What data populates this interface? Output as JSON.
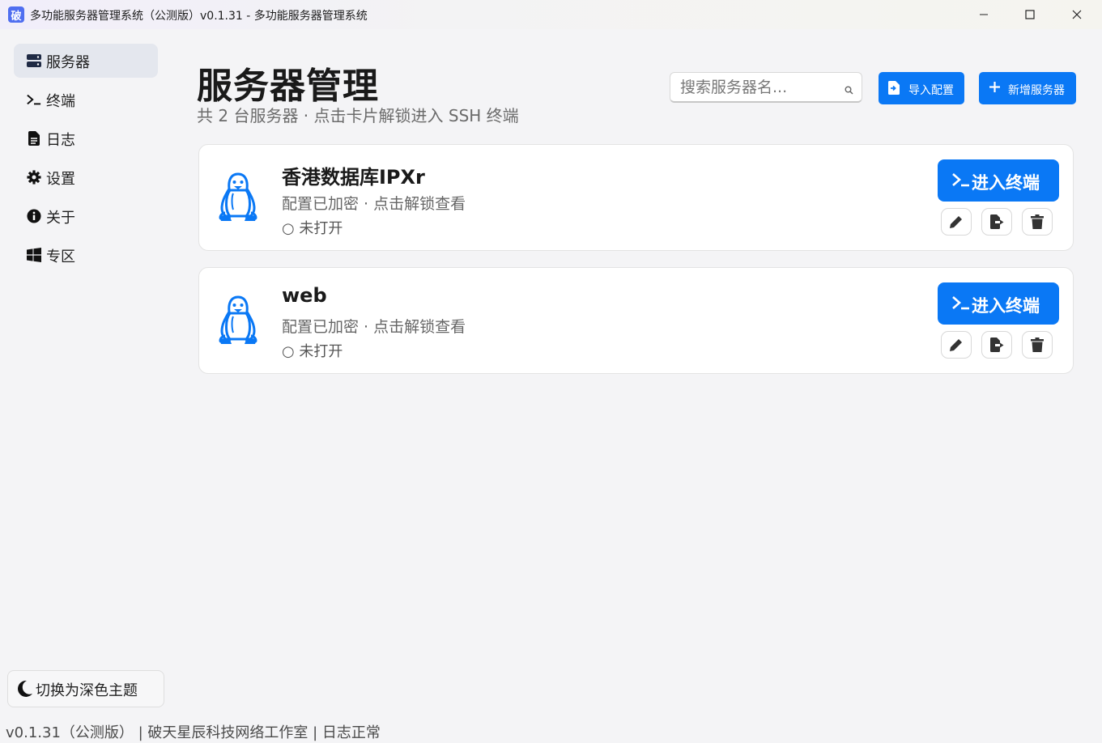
{
  "window": {
    "app_icon_char": "破",
    "title": "多功能服务器管理系统（公测版）v0.1.31 - 多功能服务器管理系统"
  },
  "sidebar": {
    "items": [
      {
        "label": "服务器",
        "icon": "server-icon",
        "active": true
      },
      {
        "label": "终端",
        "icon": "terminal-icon",
        "active": false
      },
      {
        "label": "日志",
        "icon": "file-icon",
        "active": false
      },
      {
        "label": "设置",
        "icon": "gear-icon",
        "active": false
      },
      {
        "label": "关于",
        "icon": "info-icon",
        "active": false
      },
      {
        "label": "专区",
        "icon": "windows-icon",
        "active": false
      }
    ],
    "theme_toggle": "切换为深色主题"
  },
  "header": {
    "title": "服务器管理",
    "subtitle": "共 2 台服务器 · 点击卡片解锁进入 SSH 终端",
    "search_placeholder": "搜索服务器名...",
    "import_label": "导入配置",
    "new_label": "新增服务器"
  },
  "servers": [
    {
      "name": "香港数据库IPXr",
      "desc": "配置已加密 · 点击解锁查看",
      "status": "○ 未打开",
      "enter_label": "进入终端",
      "os_icon": "linux-penguin-icon"
    },
    {
      "name": "web",
      "desc": "配置已加密 · 点击解锁查看",
      "status": "○ 未打开",
      "enter_label": "进入终端",
      "os_icon": "linux-penguin-icon"
    }
  ],
  "footer": "v0.1.31（公测版） | 破天星辰科技网络工作室 | 日志正常",
  "colors": {
    "accent": "#0a78f5",
    "active_nav": "#e4e7ee",
    "background": "#f4f4f6"
  }
}
